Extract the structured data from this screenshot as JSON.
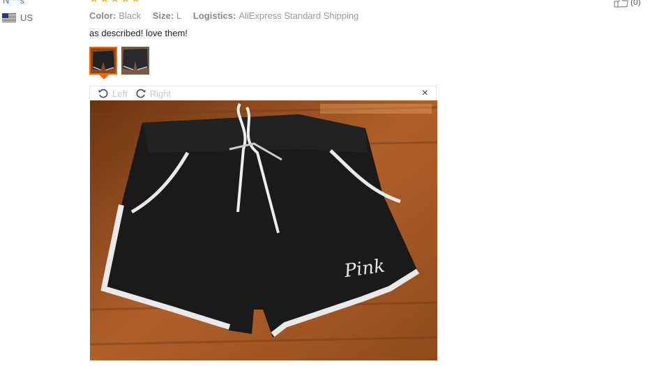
{
  "reviewer": {
    "name": "N***s",
    "country": "US"
  },
  "rating": {
    "stars": 5,
    "max": 5
  },
  "attributes": [
    {
      "key": "Color:",
      "value": "Black"
    },
    {
      "key": "Size:",
      "value": "L"
    },
    {
      "key": "Logistics:",
      "value": "AliExpress Standard Shipping"
    }
  ],
  "review_text": "as described! love them!",
  "photos": {
    "count": 2,
    "active_index": 0
  },
  "viewer": {
    "rotate_left_label": "Left",
    "rotate_right_label": "Right",
    "close_symbol": "×",
    "image_text": "Pink"
  },
  "helpful": {
    "count": "(0)"
  },
  "colors": {
    "accent": "#ff6600",
    "star": "#f5a623",
    "link": "#3b6fb5"
  }
}
